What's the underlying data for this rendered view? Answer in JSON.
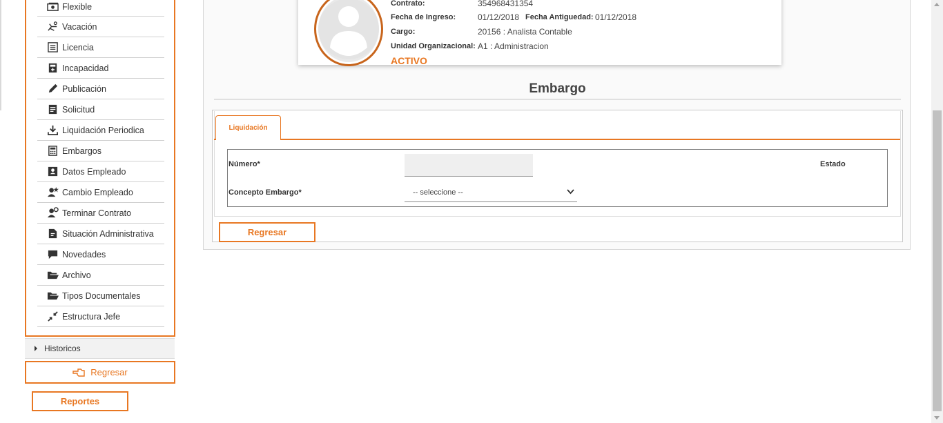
{
  "sidebar": {
    "items": [
      {
        "label": "Flexible",
        "icon": "money-icon"
      },
      {
        "label": "Vacación",
        "icon": "beach-chair-icon"
      },
      {
        "label": "Licencia",
        "icon": "list-icon"
      },
      {
        "label": "Incapacidad",
        "icon": "medical-book-icon"
      },
      {
        "label": "Publicación",
        "icon": "pen-icon"
      },
      {
        "label": "Solicitud",
        "icon": "document-icon"
      },
      {
        "label": "Liquidación Periodica",
        "icon": "download-icon"
      },
      {
        "label": "Embargos",
        "icon": "calculator-icon"
      },
      {
        "label": "Datos Empleado",
        "icon": "id-card-icon"
      },
      {
        "label": "Cambio Empleado",
        "icon": "user-star-icon"
      },
      {
        "label": "Terminar Contrato",
        "icon": "user-remove-icon"
      },
      {
        "label": "Situación Administrativa",
        "icon": "file-status-icon"
      },
      {
        "label": "Novedades",
        "icon": "comment-icon"
      },
      {
        "label": "Archivo",
        "icon": "folder-open-icon"
      },
      {
        "label": "Tipos Documentales",
        "icon": "folder-open-icon"
      },
      {
        "label": "Estructura Jefe",
        "icon": "compress-icon"
      }
    ],
    "historicos": "Historicos",
    "back_label": "Regresar",
    "reports_label": "Reportes"
  },
  "employee": {
    "contract_label": "Contrato:",
    "contract_value": "354968431354",
    "ingreso_label": "Fecha de Ingreso:",
    "ingreso_value": "01/12/2018",
    "antiguedad_label": "Fecha Antiguedad:",
    "antiguedad_value": "01/12/2018",
    "cargo_label": "Cargo:",
    "cargo_value": "20156 : Analista Contable",
    "unidad_label": "Unidad Organizacional:",
    "unidad_value": "A1 : Administracion",
    "status": "ACTIVO"
  },
  "section": {
    "title": "Embargo",
    "tab_label": "Liquidación",
    "numero_label": "Número*",
    "numero_value": "",
    "estado_label": "Estado",
    "concepto_label": "Concepto Embargo*",
    "concepto_selected": "-- seleccione --",
    "back_label": "Regresar"
  },
  "colors": {
    "accent": "#e87722",
    "status": "#e87722"
  }
}
